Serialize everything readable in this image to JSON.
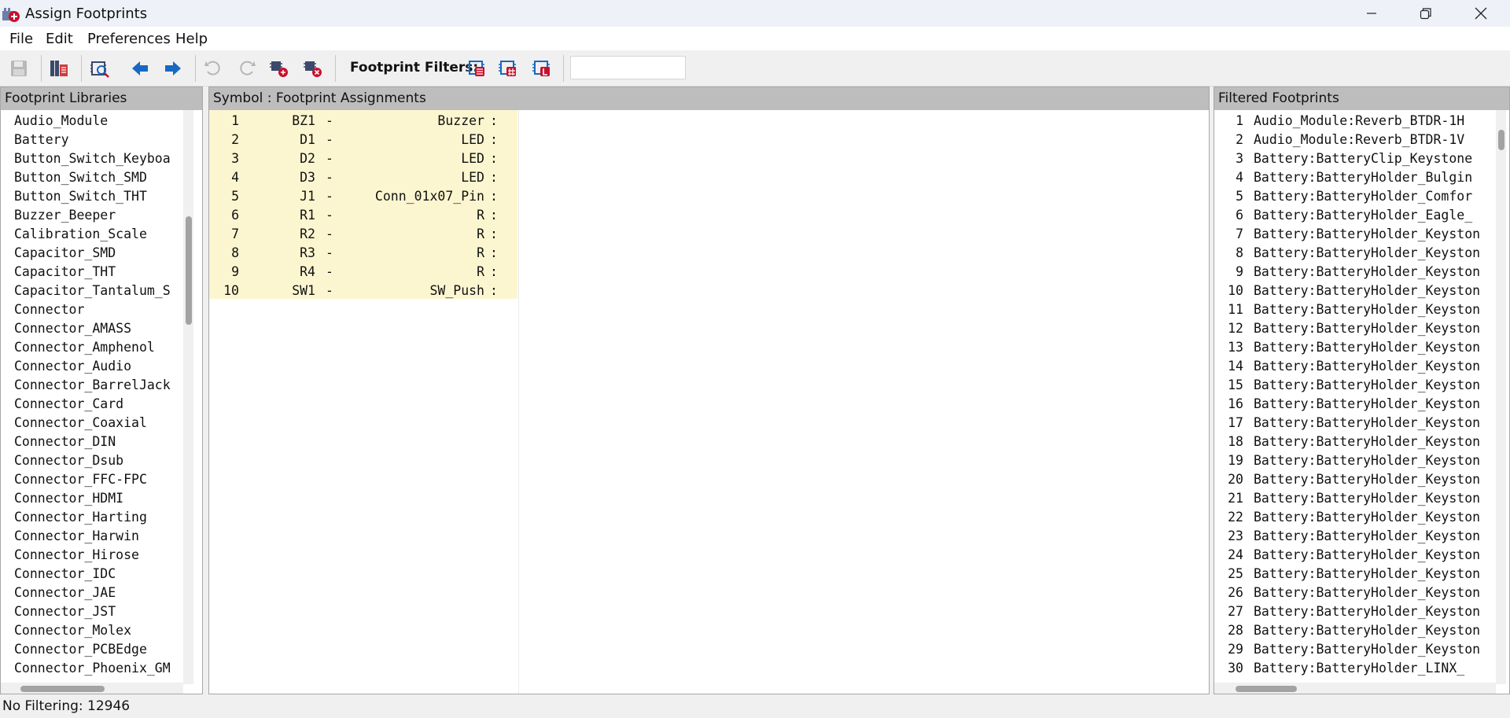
{
  "window": {
    "title": "Assign Footprints"
  },
  "menu": [
    "File",
    "Edit",
    "Preferences",
    "Help"
  ],
  "toolbar": {
    "filters_label": "Footprint Filters:",
    "filter_input_value": "",
    "icons": [
      "save-icon",
      "footprint-libraries-icon",
      "view-footprint-icon",
      "previous-icon",
      "next-icon",
      "undo-icon",
      "redo-icon",
      "auto-associate-icon",
      "delete-associations-icon",
      "filter-by-keywords-icon",
      "filter-by-pin-count-icon",
      "filter-by-library-icon"
    ]
  },
  "libraries": {
    "title": "Footprint Libraries",
    "items": [
      "Audio_Module",
      "Battery",
      "Button_Switch_Keyboa",
      "Button_Switch_SMD",
      "Button_Switch_THT",
      "Buzzer_Beeper",
      "Calibration_Scale",
      "Capacitor_SMD",
      "Capacitor_THT",
      "Capacitor_Tantalum_S",
      "Connector",
      "Connector_AMASS",
      "Connector_Amphenol",
      "Connector_Audio",
      "Connector_BarrelJack",
      "Connector_Card",
      "Connector_Coaxial",
      "Connector_DIN",
      "Connector_Dsub",
      "Connector_FFC-FPC",
      "Connector_HDMI",
      "Connector_Harting",
      "Connector_Harwin",
      "Connector_Hirose",
      "Connector_IDC",
      "Connector_JAE",
      "Connector_JST",
      "Connector_Molex",
      "Connector_PCBEdge",
      "Connector_Phoenix_GM"
    ]
  },
  "assignments": {
    "title": "Symbol : Footprint Assignments",
    "rows": [
      {
        "num": "1",
        "ref": "BZ1",
        "dash": "-",
        "value": "Buzzer",
        "colon": ":"
      },
      {
        "num": "2",
        "ref": "D1",
        "dash": "-",
        "value": "LED",
        "colon": ":"
      },
      {
        "num": "3",
        "ref": "D2",
        "dash": "-",
        "value": "LED",
        "colon": ":"
      },
      {
        "num": "4",
        "ref": "D3",
        "dash": "-",
        "value": "LED",
        "colon": ":"
      },
      {
        "num": "5",
        "ref": "J1",
        "dash": "-",
        "value": "Conn_01x07_Pin",
        "colon": ":"
      },
      {
        "num": "6",
        "ref": "R1",
        "dash": "-",
        "value": "R",
        "colon": ":"
      },
      {
        "num": "7",
        "ref": "R2",
        "dash": "-",
        "value": "R",
        "colon": ":"
      },
      {
        "num": "8",
        "ref": "R3",
        "dash": "-",
        "value": "R",
        "colon": ":"
      },
      {
        "num": "9",
        "ref": "R4",
        "dash": "-",
        "value": "R",
        "colon": ":"
      },
      {
        "num": "10",
        "ref": "SW1",
        "dash": "-",
        "value": "SW_Push",
        "colon": ":"
      }
    ]
  },
  "footprints": {
    "title": "Filtered Footprints",
    "rows": [
      {
        "num": "1",
        "name": "Audio_Module:Reverb_BTDR-1H"
      },
      {
        "num": "2",
        "name": "Audio_Module:Reverb_BTDR-1V"
      },
      {
        "num": "3",
        "name": "Battery:BatteryClip_Keystone"
      },
      {
        "num": "4",
        "name": "Battery:BatteryHolder_Bulgin"
      },
      {
        "num": "5",
        "name": "Battery:BatteryHolder_Comfor"
      },
      {
        "num": "6",
        "name": "Battery:BatteryHolder_Eagle_"
      },
      {
        "num": "7",
        "name": "Battery:BatteryHolder_Keyston"
      },
      {
        "num": "8",
        "name": "Battery:BatteryHolder_Keyston"
      },
      {
        "num": "9",
        "name": "Battery:BatteryHolder_Keyston"
      },
      {
        "num": "10",
        "name": "Battery:BatteryHolder_Keyston"
      },
      {
        "num": "11",
        "name": "Battery:BatteryHolder_Keyston"
      },
      {
        "num": "12",
        "name": "Battery:BatteryHolder_Keyston"
      },
      {
        "num": "13",
        "name": "Battery:BatteryHolder_Keyston"
      },
      {
        "num": "14",
        "name": "Battery:BatteryHolder_Keyston"
      },
      {
        "num": "15",
        "name": "Battery:BatteryHolder_Keyston"
      },
      {
        "num": "16",
        "name": "Battery:BatteryHolder_Keyston"
      },
      {
        "num": "17",
        "name": "Battery:BatteryHolder_Keyston"
      },
      {
        "num": "18",
        "name": "Battery:BatteryHolder_Keyston"
      },
      {
        "num": "19",
        "name": "Battery:BatteryHolder_Keyston"
      },
      {
        "num": "20",
        "name": "Battery:BatteryHolder_Keyston"
      },
      {
        "num": "21",
        "name": "Battery:BatteryHolder_Keyston"
      },
      {
        "num": "22",
        "name": "Battery:BatteryHolder_Keyston"
      },
      {
        "num": "23",
        "name": "Battery:BatteryHolder_Keyston"
      },
      {
        "num": "24",
        "name": "Battery:BatteryHolder_Keyston"
      },
      {
        "num": "25",
        "name": "Battery:BatteryHolder_Keyston"
      },
      {
        "num": "26",
        "name": "Battery:BatteryHolder_Keyston"
      },
      {
        "num": "27",
        "name": "Battery:BatteryHolder_Keyston"
      },
      {
        "num": "28",
        "name": "Battery:BatteryHolder_Keyston"
      },
      {
        "num": "29",
        "name": "Battery:BatteryHolder_Keyston"
      },
      {
        "num": "30",
        "name": "Battery:BatteryHolder_LINX_"
      }
    ]
  },
  "status": {
    "text": "No Filtering: 12946"
  }
}
